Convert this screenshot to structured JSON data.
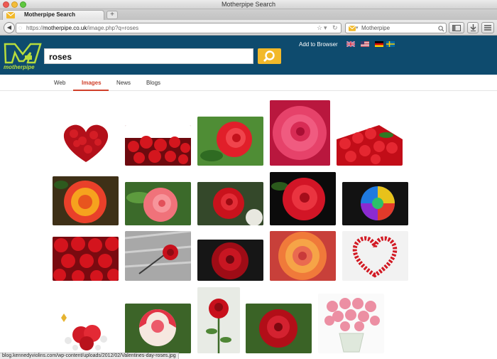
{
  "window": {
    "title": "Motherpipe Search"
  },
  "browser_tab": {
    "label": "Motherpipe Search",
    "new_tab_symbol": "+"
  },
  "navbar": {
    "url_prefix": "https://",
    "url_domain": "motherpipe.co.uk",
    "url_path": "/image.php?q=roses",
    "search_engine_label": "Motherpipe",
    "back_symbol": "◀"
  },
  "site": {
    "logo_text": "motherpipe",
    "query": "roses",
    "add_to_browser": "Add to Browser",
    "accent": "#f2b92a",
    "banner_color": "#0e4b6e"
  },
  "vertical_tabs": [
    {
      "label": "Web",
      "selected": false
    },
    {
      "label": "Images",
      "selected": true
    },
    {
      "label": "News",
      "selected": false
    },
    {
      "label": "Blogs",
      "selected": false
    }
  ],
  "results": [
    {
      "subject": "heart of red roses"
    },
    {
      "subject": "bouquet of red roses"
    },
    {
      "subject": "red rose with leaves"
    },
    {
      "subject": "pink rose closeup"
    },
    {
      "subject": "red roses with leaves"
    },
    {
      "subject": "red and yellow rose"
    },
    {
      "subject": "pink rose"
    },
    {
      "subject": "red rose on dark background"
    },
    {
      "subject": "red rose on black"
    },
    {
      "subject": "rainbow rose"
    },
    {
      "subject": "field of red roses"
    },
    {
      "subject": "single red rose on grey"
    },
    {
      "subject": "dark red rose"
    },
    {
      "subject": "orange pink rose"
    },
    {
      "subject": "heart wreath of roses"
    },
    {
      "subject": "red roses with baby breath"
    },
    {
      "subject": "pink and white rose"
    },
    {
      "subject": "single red rose on white"
    },
    {
      "subject": "red rose on green"
    },
    {
      "subject": "vase of pink roses"
    }
  ],
  "status_bar": "blog.kennedyviolins.com/wp-content/uploads/2012/02/Valentines-day-roses.jpg"
}
